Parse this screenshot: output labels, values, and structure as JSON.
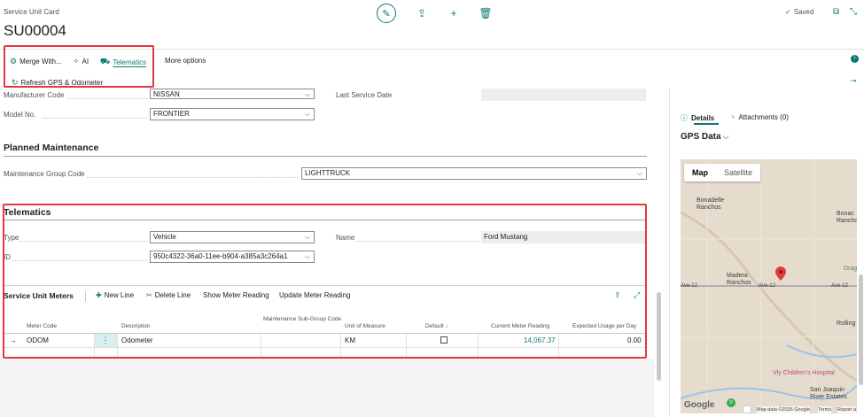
{
  "header": {
    "caption": "Service Unit Card",
    "title": "SU00004",
    "saved_label": "Saved"
  },
  "actions": {
    "merge_with": "Merge With...",
    "ai": "AI",
    "telematics": "Telematics",
    "more_options": "More options",
    "refresh": "Refresh GPS & Odometer"
  },
  "general": {
    "manufacturer_code_label": "Manufacturer Code",
    "manufacturer_code_value": "NISSAN",
    "model_no_label": "Model No.",
    "model_no_value": "FRONTIER",
    "last_service_date_label": "Last Service Date"
  },
  "planned": {
    "title": "Planned Maintenance",
    "group_code_label": "Maintenance Group Code",
    "group_code_value": "LIGHTTRUCK"
  },
  "telematics": {
    "title": "Telematics",
    "type_label": "Type",
    "type_value": "Vehicle",
    "id_label": "ID",
    "id_value": "950c4322-36a0-11ee-b904-a385a3c264a1",
    "name_label": "Name",
    "name_value": "Ford Mustang"
  },
  "meters": {
    "title": "Service Unit Meters",
    "new_line": "New Line",
    "delete_line": "Delete Line",
    "show_reading": "Show Meter Reading",
    "update_reading": "Update Meter Reading",
    "columns": {
      "meter_code": "Meter Code",
      "description": "Description",
      "sub_group": "Maintenance Sub-Group Code",
      "uom": "Unit of Measure",
      "default": "Default",
      "current": "Current Meter Reading",
      "expected": "Expected Usage per Day"
    },
    "rows": [
      {
        "meter_code": "ODOM",
        "description": "Odometer",
        "sub_group": "",
        "uom": "KM",
        "default": false,
        "current": "14,067.37",
        "expected": "0.00"
      }
    ]
  },
  "factbox": {
    "tab_details": "Details",
    "tab_attachments": "Attachments (0)",
    "gps_title": "GPS Data"
  },
  "map": {
    "map_btn": "Map",
    "satellite_btn": "Satellite",
    "labels": {
      "bonadelle": "Bonadelle Ranchos",
      "bonad_right": "Bonac Ranchos",
      "madera": "Madera Ranchos",
      "ave12_left": "Ave-12",
      "ave12_mid": "Ave-12",
      "ave12_right": "Ave-12",
      "drag": "Drag",
      "rolling": "Rolling",
      "hospital": "Vly Children's Hospital",
      "san_joaquin": "San Joaquin River Estates",
      "google": "Google",
      "footer_data": "Map data ©2026 Google",
      "terms": "Terms",
      "report": "Report a"
    }
  },
  "colors": {
    "accent": "#0b7a6e",
    "highlight_border": "#e0393e",
    "map_pin": "#e03b3b"
  }
}
